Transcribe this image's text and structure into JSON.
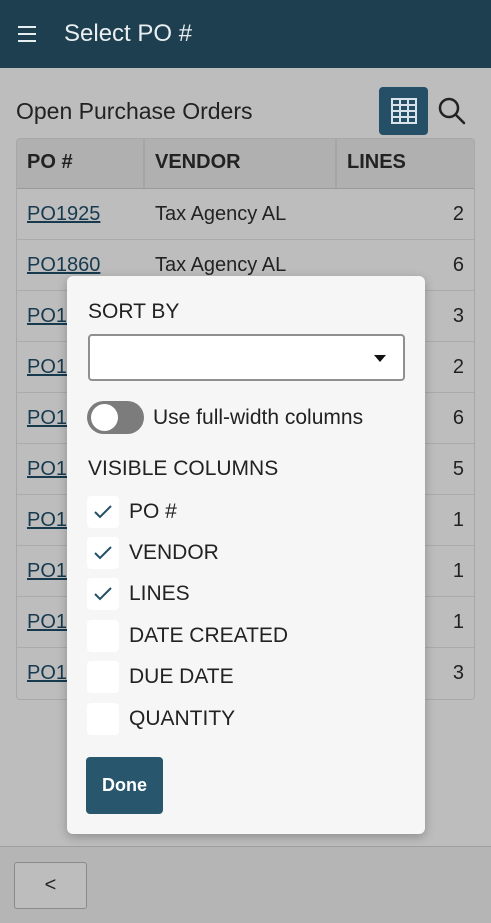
{
  "header": {
    "title": "Select PO #"
  },
  "main": {
    "section_title": "Open Purchase Orders",
    "table": {
      "columns": [
        "PO #",
        "VENDOR",
        "LINES"
      ],
      "rows": [
        {
          "po": "PO1925",
          "vendor": "Tax Agency AL",
          "lines": "2"
        },
        {
          "po": "PO1860",
          "vendor": "Tax Agency AL",
          "lines": "6"
        },
        {
          "po": "PO1",
          "vendor": "",
          "lines": "3"
        },
        {
          "po": "PO1",
          "vendor": "",
          "lines": "2"
        },
        {
          "po": "PO1",
          "vendor": "",
          "lines": "6"
        },
        {
          "po": "PO1",
          "vendor": "",
          "lines": "5"
        },
        {
          "po": "PO1",
          "vendor": "",
          "lines": "1"
        },
        {
          "po": "PO1",
          "vendor": "",
          "lines": "1"
        },
        {
          "po": "PO1",
          "vendor": "",
          "lines": "1"
        },
        {
          "po": "PO1",
          "vendor": "",
          "lines": "3"
        }
      ]
    }
  },
  "dialog": {
    "sort_by_label": "SORT BY",
    "sort_value": "",
    "toggle_label": "Use full-width columns",
    "toggle_on": false,
    "visible_columns_label": "VISIBLE COLUMNS",
    "columns": [
      {
        "label": "PO #",
        "checked": true
      },
      {
        "label": "VENDOR",
        "checked": true
      },
      {
        "label": "LINES",
        "checked": true
      },
      {
        "label": "DATE CREATED",
        "checked": false
      },
      {
        "label": "DUE DATE",
        "checked": false
      },
      {
        "label": "QUANTITY",
        "checked": false
      }
    ],
    "done_label": "Done"
  },
  "footer": {
    "back_label": "<"
  },
  "colors": {
    "header_bg": "#1e3f4f",
    "accent": "#27566d",
    "link": "#173a4f"
  },
  "icons": {
    "menu": "hamburger-icon",
    "grid": "grid-icon",
    "search": "search-icon",
    "sort_caret": "chevron-down-icon",
    "check": "check-icon"
  }
}
